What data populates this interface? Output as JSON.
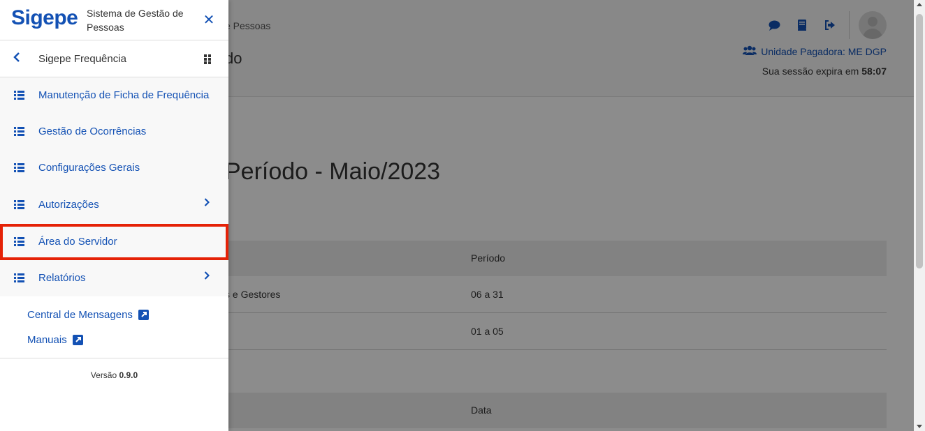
{
  "background": {
    "breadcrumb": "e Pessoas",
    "page_title_partial": "do",
    "unidade_label": "Unidade Pagadora: ME DGP",
    "session_prefix": "Sua sessão expira em",
    "session_time": "58:07",
    "period_title": "Período - Maio/2023",
    "table1": {
      "header": "Período",
      "rows": [
        {
          "partial_label": "s e Gestores",
          "value": "06 a 31"
        },
        {
          "partial_label": "",
          "value": "01 a 05"
        }
      ]
    },
    "table2": {
      "header": "Data"
    },
    "icons": [
      "comment-icon",
      "book-icon",
      "sign-out-icon",
      "users-icon"
    ]
  },
  "sidebar": {
    "logo": "Sigepe",
    "logo_subtitle": "Sistema de Gestão de Pessoas",
    "close_icon": "times-icon",
    "submenu_title": "Sigepe Frequência",
    "items": [
      {
        "label": "Manutenção de Ficha de Frequência",
        "has_children": false
      },
      {
        "label": "Gestão de Ocorrências",
        "has_children": false
      },
      {
        "label": "Configurações Gerais",
        "has_children": false
      },
      {
        "label": "Autorizações",
        "has_children": true
      },
      {
        "label": "Área do Servidor",
        "has_children": false,
        "highlighted": true
      },
      {
        "label": "Relatórios",
        "has_children": true
      }
    ],
    "links": [
      {
        "label": "Central de Mensagens"
      },
      {
        "label": "Manuais"
      }
    ],
    "version_prefix": "Versão",
    "version_number": "0.9.0"
  },
  "colors": {
    "primary": "#1351b4",
    "highlight_border": "#e52207"
  }
}
